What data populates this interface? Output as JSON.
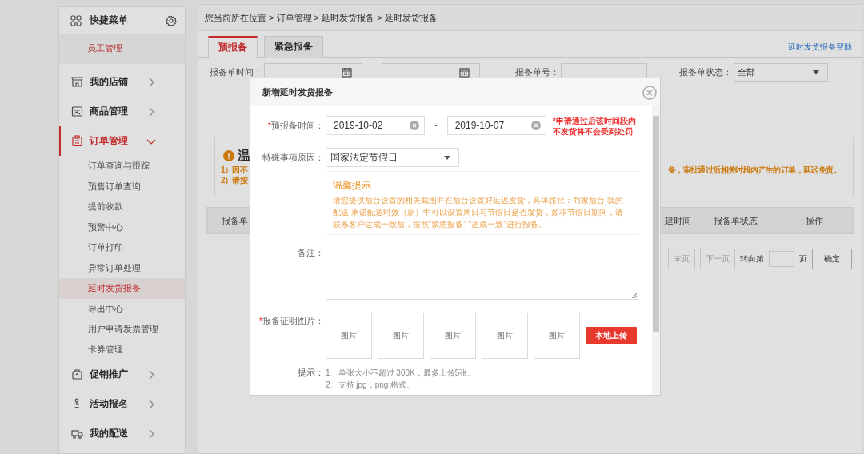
{
  "sidebar": {
    "quick_menu": {
      "title": "快捷菜单",
      "items": [
        {
          "label": "员工管理",
          "selected": false
        }
      ]
    },
    "menus": [
      {
        "label": "我的店铺",
        "expanded": false,
        "selected": false
      },
      {
        "label": "商品管理",
        "expanded": false,
        "selected": false
      },
      {
        "label": "订单管理",
        "expanded": true,
        "selected": true,
        "children": [
          {
            "label": "订单查询与跟踪",
            "selected": false
          },
          {
            "label": "预售订单查询",
            "selected": false
          },
          {
            "label": "提前收款",
            "selected": false
          },
          {
            "label": "预警中心",
            "selected": false
          },
          {
            "label": "订单打印",
            "selected": false
          },
          {
            "label": "异常订单处理",
            "selected": false
          },
          {
            "label": "延时发货报备",
            "selected": true
          },
          {
            "label": "导出中心",
            "selected": false
          },
          {
            "label": "用户申请发票管理",
            "selected": false
          },
          {
            "label": "卡券管理",
            "selected": false
          }
        ]
      },
      {
        "label": "促销推广",
        "expanded": false,
        "selected": false
      },
      {
        "label": "活动报名",
        "expanded": false,
        "selected": false
      },
      {
        "label": "我的配送",
        "expanded": false,
        "selected": false
      }
    ]
  },
  "main": {
    "breadcrumb": "您当前所在位置 > 订单管理 > 延时发货报备 > 延时发货报备",
    "tabs": [
      {
        "label": "预报备",
        "selected": true
      },
      {
        "label": "紧急报备",
        "selected": false
      }
    ],
    "help_link": "延时发货报备帮助",
    "filters": {
      "time_label": "报备单时间：",
      "dash": "-",
      "number_label": "报备单号：",
      "status_label": "报备单状态：",
      "status_value": "全部"
    },
    "notice": {
      "title": "温",
      "lines": [
        "1）因不",
        "2）请按"
      ],
      "line_end": "备，审批通过后相关时段内产生的订单，延迟免责。"
    },
    "table": {
      "columns": [
        "报备单",
        "建时间",
        "报备单状态",
        "操作"
      ]
    },
    "pagination": {
      "buttons": [
        "末页",
        "下一页"
      ],
      "goto_label": "转向第",
      "page_label": "页",
      "confirm": "确定"
    }
  },
  "dialog": {
    "title": "新增延时发货报备",
    "date_row": {
      "required_mark": "*",
      "label": "预报备时间：",
      "start": "2019-10-02",
      "dash": "-",
      "end": "2019-10-07",
      "warning": "*申请通过后该时间段内不发货将不会受到处罚"
    },
    "reason_row": {
      "label": "特殊事项原因：",
      "value": "国家法定节假日"
    },
    "tip": {
      "title": "温馨提示",
      "text": "请您提供后台设置的相关截图并在后台设置好延迟发货，具体路径：商家后台-我的配送-承诺配送时效（新）中可以设置周日与节假日是否发货，如非节假日期间，请联系客户达成一致后，按照“紧急报备”-“达成一致”进行报备。"
    },
    "remark_row": {
      "label": "备注："
    },
    "photo_row": {
      "required_mark": "*",
      "label": "报备证明图片：",
      "slots": [
        "图片",
        "图片",
        "图片",
        "图片",
        "图片"
      ],
      "upload": "本地上传"
    },
    "hints": {
      "label": "提示：",
      "lines": [
        "1、单张大小不超过 300K，最多上传5张。",
        "2、支持 jpg，png 格式。"
      ]
    }
  }
}
